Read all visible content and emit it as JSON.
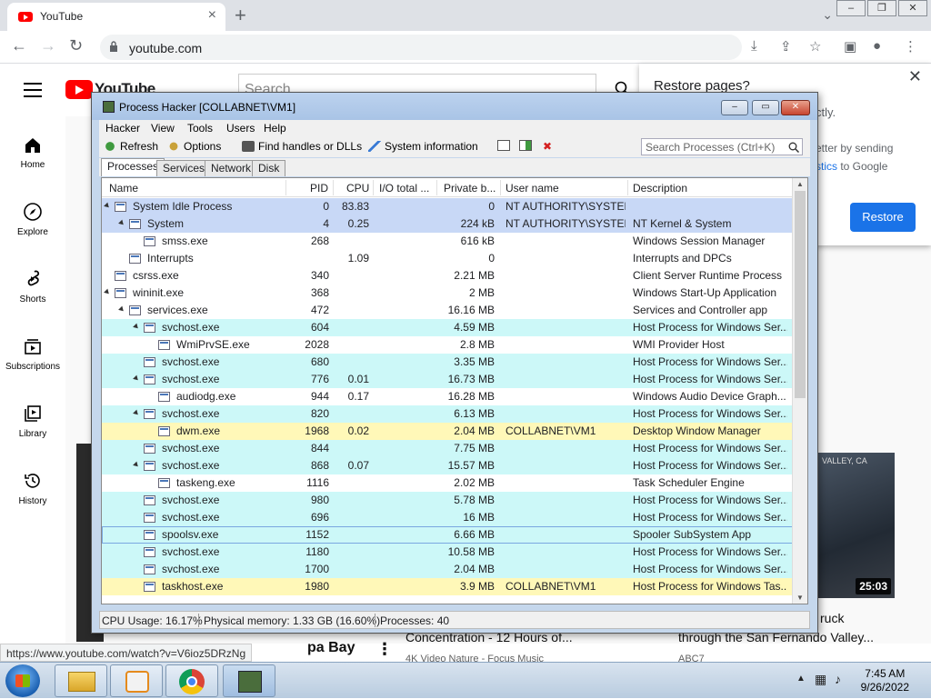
{
  "browser": {
    "tab_title": "YouTube",
    "url": "youtube.com",
    "status_url": "https://www.youtube.com/watch?v=V6ioz5DRzNg"
  },
  "youtube": {
    "logo_text": "YouTube",
    "search_placeholder": "Search",
    "sidebar": [
      {
        "label": "Home",
        "icon": "home-icon"
      },
      {
        "label": "Explore",
        "icon": "compass-icon"
      },
      {
        "label": "Shorts",
        "icon": "shorts-icon"
      },
      {
        "label": "Subscriptions",
        "icon": "subscriptions-icon"
      },
      {
        "label": "Library",
        "icon": "library-icon"
      },
      {
        "label": "History",
        "icon": "history-icon"
      }
    ],
    "video_duration": "25:03",
    "video_location": "VALLEY, CA",
    "bottom_texts": {
      "title_left": "pa Bay",
      "title_mid": "Concentration - 12 Hours of...",
      "channel_mid": "4K Video Nature - Focus Music",
      "title_right_1": "ruck",
      "title_right_2": "through the San Fernando Valley...",
      "channel_right": "ABC7"
    }
  },
  "restore_popup": {
    "title": "Restore pages?",
    "text1": "ctly.",
    "text2": "etter by sending",
    "text3_link": "stics",
    "text3_rest": " to Google",
    "button": "Restore"
  },
  "process_hacker": {
    "title": "Process Hacker [COLLABNET\\VM1]",
    "menu": [
      "Hacker",
      "View",
      "Tools",
      "Users",
      "Help"
    ],
    "toolbar": {
      "refresh": "Refresh",
      "options": "Options",
      "find": "Find handles or DLLs",
      "sysinfo": "System information",
      "search_placeholder": "Search Processes (Ctrl+K)"
    },
    "tabs": [
      "Processes",
      "Services",
      "Network",
      "Disk"
    ],
    "columns": [
      "Name",
      "PID",
      "CPU",
      "I/O total ...",
      "Private b...",
      "User name",
      "Description"
    ],
    "rows": [
      {
        "depth": 0,
        "exp": true,
        "name": "System Idle Process",
        "pid": "0",
        "cpu": "83.83",
        "io": "",
        "priv": "0",
        "user": "NT AUTHORITY\\SYSTEM",
        "desc": "",
        "bg": "#c8d8f6"
      },
      {
        "depth": 1,
        "exp": true,
        "name": "System",
        "pid": "4",
        "cpu": "0.25",
        "io": "",
        "priv": "224 kB",
        "user": "NT AUTHORITY\\SYSTEM",
        "desc": "NT Kernel & System",
        "bg": "#c8d8f6"
      },
      {
        "depth": 2,
        "exp": false,
        "name": "smss.exe",
        "pid": "268",
        "cpu": "",
        "io": "",
        "priv": "616 kB",
        "user": "",
        "desc": "Windows Session Manager",
        "bg": ""
      },
      {
        "depth": 1,
        "exp": false,
        "name": "Interrupts",
        "pid": "",
        "cpu": "1.09",
        "io": "",
        "priv": "0",
        "user": "",
        "desc": "Interrupts and DPCs",
        "bg": ""
      },
      {
        "depth": 0,
        "exp": false,
        "name": "csrss.exe",
        "pid": "340",
        "cpu": "",
        "io": "",
        "priv": "2.21 MB",
        "user": "",
        "desc": "Client Server Runtime Process",
        "bg": ""
      },
      {
        "depth": 0,
        "exp": true,
        "name": "wininit.exe",
        "pid": "368",
        "cpu": "",
        "io": "",
        "priv": "2 MB",
        "user": "",
        "desc": "Windows Start-Up Application",
        "bg": ""
      },
      {
        "depth": 1,
        "exp": true,
        "name": "services.exe",
        "pid": "472",
        "cpu": "",
        "io": "",
        "priv": "16.16 MB",
        "user": "",
        "desc": "Services and Controller app",
        "bg": ""
      },
      {
        "depth": 2,
        "exp": true,
        "name": "svchost.exe",
        "pid": "604",
        "cpu": "",
        "io": "",
        "priv": "4.59 MB",
        "user": "",
        "desc": "Host Process for Windows Ser...",
        "bg": "#ccf8f8"
      },
      {
        "depth": 3,
        "exp": false,
        "name": "WmiPrvSE.exe",
        "pid": "2028",
        "cpu": "",
        "io": "",
        "priv": "2.8 MB",
        "user": "",
        "desc": "WMI Provider Host",
        "bg": ""
      },
      {
        "depth": 2,
        "exp": false,
        "name": "svchost.exe",
        "pid": "680",
        "cpu": "",
        "io": "",
        "priv": "3.35 MB",
        "user": "",
        "desc": "Host Process for Windows Ser...",
        "bg": "#ccf8f8"
      },
      {
        "depth": 2,
        "exp": true,
        "name": "svchost.exe",
        "pid": "776",
        "cpu": "0.01",
        "io": "",
        "priv": "16.73 MB",
        "user": "",
        "desc": "Host Process for Windows Ser...",
        "bg": "#ccf8f8"
      },
      {
        "depth": 3,
        "exp": false,
        "name": "audiodg.exe",
        "pid": "944",
        "cpu": "0.17",
        "io": "",
        "priv": "16.28 MB",
        "user": "",
        "desc": "Windows Audio Device Graph...",
        "bg": ""
      },
      {
        "depth": 2,
        "exp": true,
        "name": "svchost.exe",
        "pid": "820",
        "cpu": "",
        "io": "",
        "priv": "6.13 MB",
        "user": "",
        "desc": "Host Process for Windows Ser...",
        "bg": "#ccf8f8"
      },
      {
        "depth": 3,
        "exp": false,
        "name": "dwm.exe",
        "pid": "1968",
        "cpu": "0.02",
        "io": "",
        "priv": "2.04 MB",
        "user": "COLLABNET\\VM1",
        "desc": "Desktop Window Manager",
        "bg": "#fff8b8"
      },
      {
        "depth": 2,
        "exp": false,
        "name": "svchost.exe",
        "pid": "844",
        "cpu": "",
        "io": "",
        "priv": "7.75 MB",
        "user": "",
        "desc": "Host Process for Windows Ser...",
        "bg": "#ccf8f8"
      },
      {
        "depth": 2,
        "exp": true,
        "name": "svchost.exe",
        "pid": "868",
        "cpu": "0.07",
        "io": "",
        "priv": "15.57 MB",
        "user": "",
        "desc": "Host Process for Windows Ser...",
        "bg": "#ccf8f8"
      },
      {
        "depth": 3,
        "exp": false,
        "name": "taskeng.exe",
        "pid": "1116",
        "cpu": "",
        "io": "",
        "priv": "2.02 MB",
        "user": "",
        "desc": "Task Scheduler Engine",
        "bg": ""
      },
      {
        "depth": 2,
        "exp": false,
        "name": "svchost.exe",
        "pid": "980",
        "cpu": "",
        "io": "",
        "priv": "5.78 MB",
        "user": "",
        "desc": "Host Process for Windows Ser...",
        "bg": "#ccf8f8"
      },
      {
        "depth": 2,
        "exp": false,
        "name": "svchost.exe",
        "pid": "696",
        "cpu": "",
        "io": "",
        "priv": "16 MB",
        "user": "",
        "desc": "Host Process for Windows Ser...",
        "bg": "#ccf8f8"
      },
      {
        "depth": 2,
        "exp": false,
        "name": "spoolsv.exe",
        "pid": "1152",
        "cpu": "",
        "io": "",
        "priv": "6.66 MB",
        "user": "",
        "desc": "Spooler SubSystem App",
        "bg": "#ccf8f8",
        "selected": true
      },
      {
        "depth": 2,
        "exp": false,
        "name": "svchost.exe",
        "pid": "1180",
        "cpu": "",
        "io": "",
        "priv": "10.58 MB",
        "user": "",
        "desc": "Host Process for Windows Ser...",
        "bg": "#ccf8f8"
      },
      {
        "depth": 2,
        "exp": false,
        "name": "svchost.exe",
        "pid": "1700",
        "cpu": "",
        "io": "",
        "priv": "2.04 MB",
        "user": "",
        "desc": "Host Process for Windows Ser...",
        "bg": "#ccf8f8"
      },
      {
        "depth": 2,
        "exp": false,
        "name": "taskhost.exe",
        "pid": "1980",
        "cpu": "",
        "io": "",
        "priv": "3.9 MB",
        "user": "COLLABNET\\VM1",
        "desc": "Host Process for Windows Tas...",
        "bg": "#fff8b8"
      }
    ],
    "status": {
      "cpu": "CPU Usage: 16.17%",
      "mem": "Physical memory: 1.33 GB (16.60%)",
      "procs": "Processes: 40"
    }
  },
  "taskbar": {
    "time": "7:45 AM",
    "date": "9/26/2022"
  },
  "colors": {
    "yt_red": "#ff0000",
    "restore_blue": "#1a73e8",
    "service_row": "#ccf8f8",
    "user_row": "#fff8b8",
    "system_row": "#c8d8f6"
  }
}
